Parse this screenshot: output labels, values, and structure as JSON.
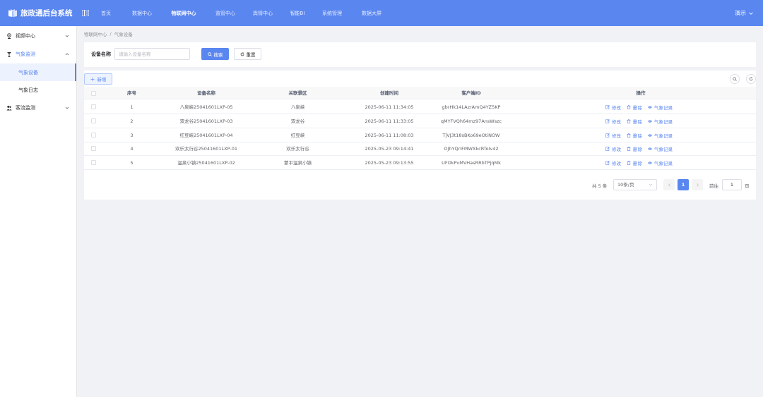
{
  "app": {
    "title": "旅政通后台系统"
  },
  "nav": [
    "首页",
    "数据中心",
    "物联网中心",
    "监管中心",
    "舆情中心",
    "智能BI",
    "系统管理",
    "数据大屏"
  ],
  "nav_active_index": 2,
  "user": {
    "name": "演示"
  },
  "sidebar": {
    "items": [
      {
        "label": "视频中心",
        "icon": "video-icon"
      },
      {
        "label": "气象监测",
        "icon": "weather-icon",
        "children": [
          "气象设备",
          "气象日志"
        ]
      },
      {
        "label": "客流监测",
        "icon": "people-icon"
      }
    ],
    "active_child": "气象设备"
  },
  "breadcrumb": [
    "物联网中心",
    "气象设备"
  ],
  "search": {
    "label": "设备名称",
    "placeholder": "请输入设备名称",
    "value": "",
    "search_label": "搜索",
    "reset_label": "重置"
  },
  "toolbar": {
    "add_label": "新增"
  },
  "table": {
    "columns": [
      "序号",
      "设备名称",
      "关联景区",
      "创建时间",
      "客户端ID",
      "操作"
    ],
    "rows": [
      [
        "1",
        "八泉峡25041601LXP-05",
        "八泉峡",
        "2025-06-11 11:34:05",
        "gbrHk14LAzrAmQ4YZ5KP"
      ],
      [
        "2",
        "双龙谷25041601LXP-03",
        "双龙谷",
        "2025-06-11 11:33:05",
        "qMYFVQh64mz97AnsWszc"
      ],
      [
        "3",
        "红豆峡25041601LXP-04",
        "红豆峡",
        "2025-06-11 11:08:03",
        "TjVJ3t18sBKo69eOtiNOW"
      ],
      [
        "4",
        "欢乐太行谷25041601LXP-01",
        "欢乐太行谷",
        "2025-05-23 09:14:41",
        "OJhYQrIFMWXkcRToIv42"
      ],
      [
        "5",
        "温泉小镇25041601LXP-02",
        "蒙平温泉小镇",
        "2025-05-23 09:13:55",
        "UFOkPvMVHasRRbTPjqMk"
      ]
    ],
    "actions": [
      "修改",
      "删除",
      "气象记录"
    ]
  },
  "pagination": {
    "total": "共 5 条",
    "page_size": "10条/页",
    "current": "1",
    "goto_label": "前往",
    "goto_value": "1",
    "unit": "页"
  },
  "colors": {
    "primary": "#5a86f0",
    "header_bg": "#5a86f0"
  }
}
